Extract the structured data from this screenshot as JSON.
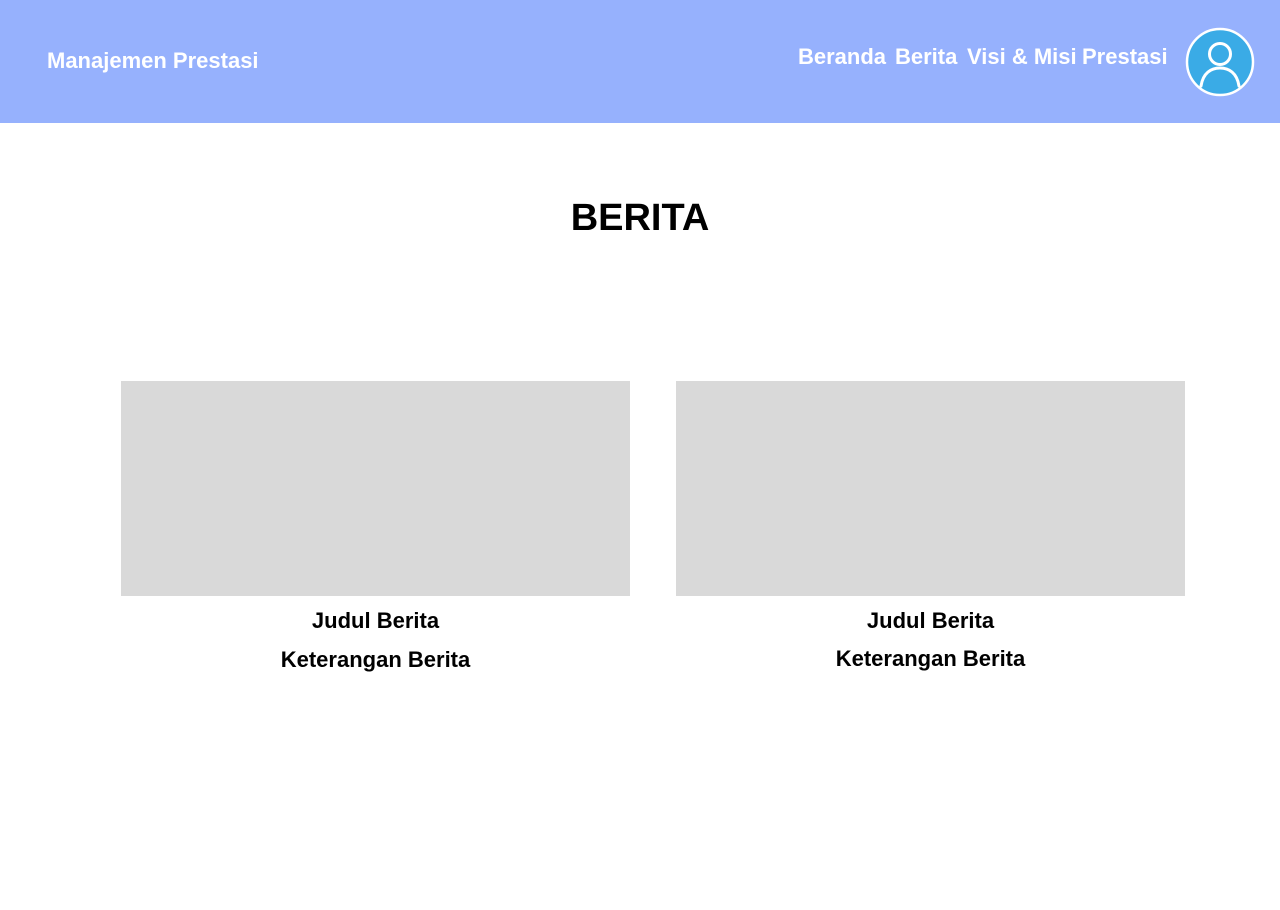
{
  "header": {
    "brand": "Manajemen Prestasi",
    "nav": [
      {
        "label": "Beranda"
      },
      {
        "label": "Berita"
      },
      {
        "label": "Visi & Misi"
      },
      {
        "label": "Prestasi"
      }
    ],
    "avatar_icon": "user-icon",
    "background_color": "#96b1fd",
    "avatar_color": "#3aabe6"
  },
  "main": {
    "title": "BERITA",
    "cards": [
      {
        "title": "Judul Berita",
        "description": "Keterangan Berita"
      },
      {
        "title": "Judul Berita",
        "description": "Keterangan Berita"
      }
    ]
  }
}
